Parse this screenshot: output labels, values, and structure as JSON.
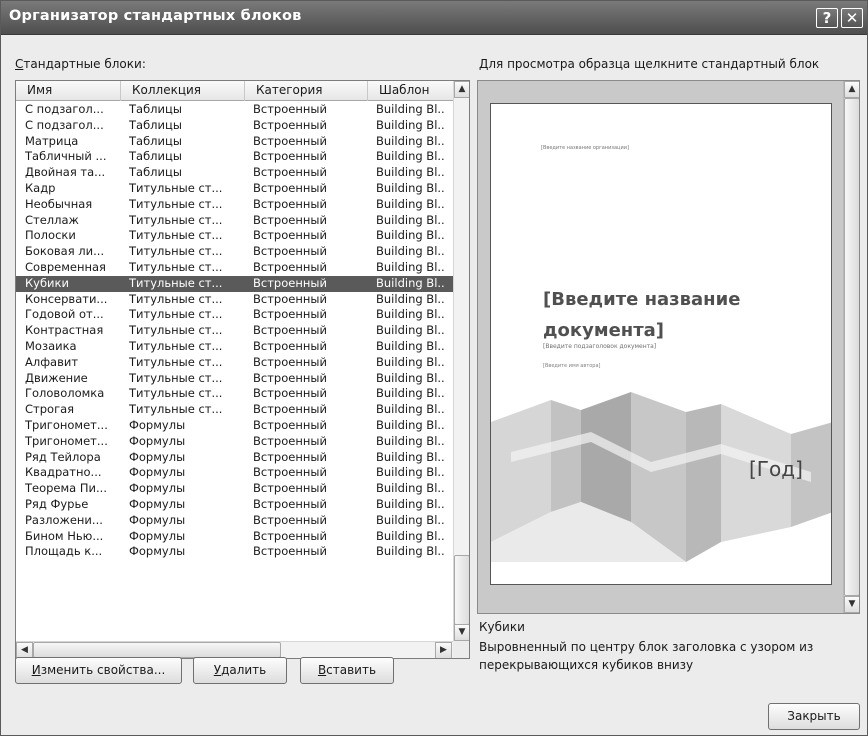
{
  "window": {
    "title": "Организатор стандартных блоков",
    "help_glyph": "?",
    "close_glyph": "✕"
  },
  "list": {
    "label": "Стандартные блоки:",
    "label_first": "С",
    "label_rest": "тандартные блоки:",
    "columns": [
      "Имя",
      "Коллекция",
      "Категория",
      "Шаблон"
    ],
    "rows": [
      [
        "С подзагол...",
        "Таблицы",
        "Встроенный",
        "Building Bl.."
      ],
      [
        "С подзагол...",
        "Таблицы",
        "Встроенный",
        "Building Bl.."
      ],
      [
        "Матрица",
        "Таблицы",
        "Встроенный",
        "Building Bl.."
      ],
      [
        "Табличный ...",
        "Таблицы",
        "Встроенный",
        "Building Bl.."
      ],
      [
        "Двойная та...",
        "Таблицы",
        "Встроенный",
        "Building Bl.."
      ],
      [
        "Кадр",
        "Титульные ст...",
        "Встроенный",
        "Building Bl.."
      ],
      [
        "Необычная",
        "Титульные ст...",
        "Встроенный",
        "Building Bl.."
      ],
      [
        "Стеллаж",
        "Титульные ст...",
        "Встроенный",
        "Building Bl.."
      ],
      [
        "Полоски",
        "Титульные ст...",
        "Встроенный",
        "Building Bl.."
      ],
      [
        "Боковая ли...",
        "Титульные ст...",
        "Встроенный",
        "Building Bl.."
      ],
      [
        "Современная",
        "Титульные ст...",
        "Встроенный",
        "Building Bl.."
      ],
      [
        "Кубики",
        "Титульные ст...",
        "Встроенный",
        "Building Bl.."
      ],
      [
        "Консервати...",
        "Титульные ст...",
        "Встроенный",
        "Building Bl.."
      ],
      [
        "Годовой от...",
        "Титульные ст...",
        "Встроенный",
        "Building Bl.."
      ],
      [
        "Контрастная",
        "Титульные ст...",
        "Встроенный",
        "Building Bl.."
      ],
      [
        "Мозаика",
        "Титульные ст...",
        "Встроенный",
        "Building Bl.."
      ],
      [
        "Алфавит",
        "Титульные ст...",
        "Встроенный",
        "Building Bl.."
      ],
      [
        "Движение",
        "Титульные ст...",
        "Встроенный",
        "Building Bl.."
      ],
      [
        "Головоломка",
        "Титульные ст...",
        "Встроенный",
        "Building Bl.."
      ],
      [
        "Строгая",
        "Титульные ст...",
        "Встроенный",
        "Building Bl.."
      ],
      [
        "Тригономет...",
        "Формулы",
        "Встроенный",
        "Building Bl.."
      ],
      [
        "Тригономет...",
        "Формулы",
        "Встроенный",
        "Building Bl.."
      ],
      [
        "Ряд Тейлора",
        "Формулы",
        "Встроенный",
        "Building Bl.."
      ],
      [
        "Квадратно...",
        "Формулы",
        "Встроенный",
        "Building Bl.."
      ],
      [
        "Теорема Пи...",
        "Формулы",
        "Встроенный",
        "Building Bl.."
      ],
      [
        "Ряд Фурье",
        "Формулы",
        "Встроенный",
        "Building Bl.."
      ],
      [
        "Разложени...",
        "Формулы",
        "Встроенный",
        "Building Bl.."
      ],
      [
        "Бином Нью...",
        "Формулы",
        "Встроенный",
        "Building Bl.."
      ],
      [
        "Площадь к...",
        "Формулы",
        "Встроенный",
        "Building Bl.."
      ]
    ],
    "selected_index": 11
  },
  "preview": {
    "label": "Для просмотра образца щелкните стандартный блок",
    "org_placeholder": "[Введите название организации]",
    "title_placeholder": "[Введите название документа]",
    "subtitle_placeholder": "[Введите подзаголовок документа]",
    "author_placeholder": "[Введите имя автора]",
    "year_placeholder": "[Год]"
  },
  "description": {
    "name": "Кубики",
    "text": "Выровненный по центру блок заголовка с узором из перекрывающихся кубиков внизу"
  },
  "buttons": {
    "edit": "Изменить свойства...",
    "edit_first": "И",
    "edit_rest": "зменить свойства...",
    "delete": "Удалить",
    "delete_first": "У",
    "delete_rest": "далить",
    "insert": "Вставить",
    "insert_first": "В",
    "insert_rest": "ставить",
    "close": "Закрыть"
  },
  "icons": {
    "scroll_up": "up-arrow-icon",
    "scroll_down": "down-arrow-icon",
    "scroll_left": "left-arrow-icon",
    "scroll_right": "right-arrow-icon"
  }
}
